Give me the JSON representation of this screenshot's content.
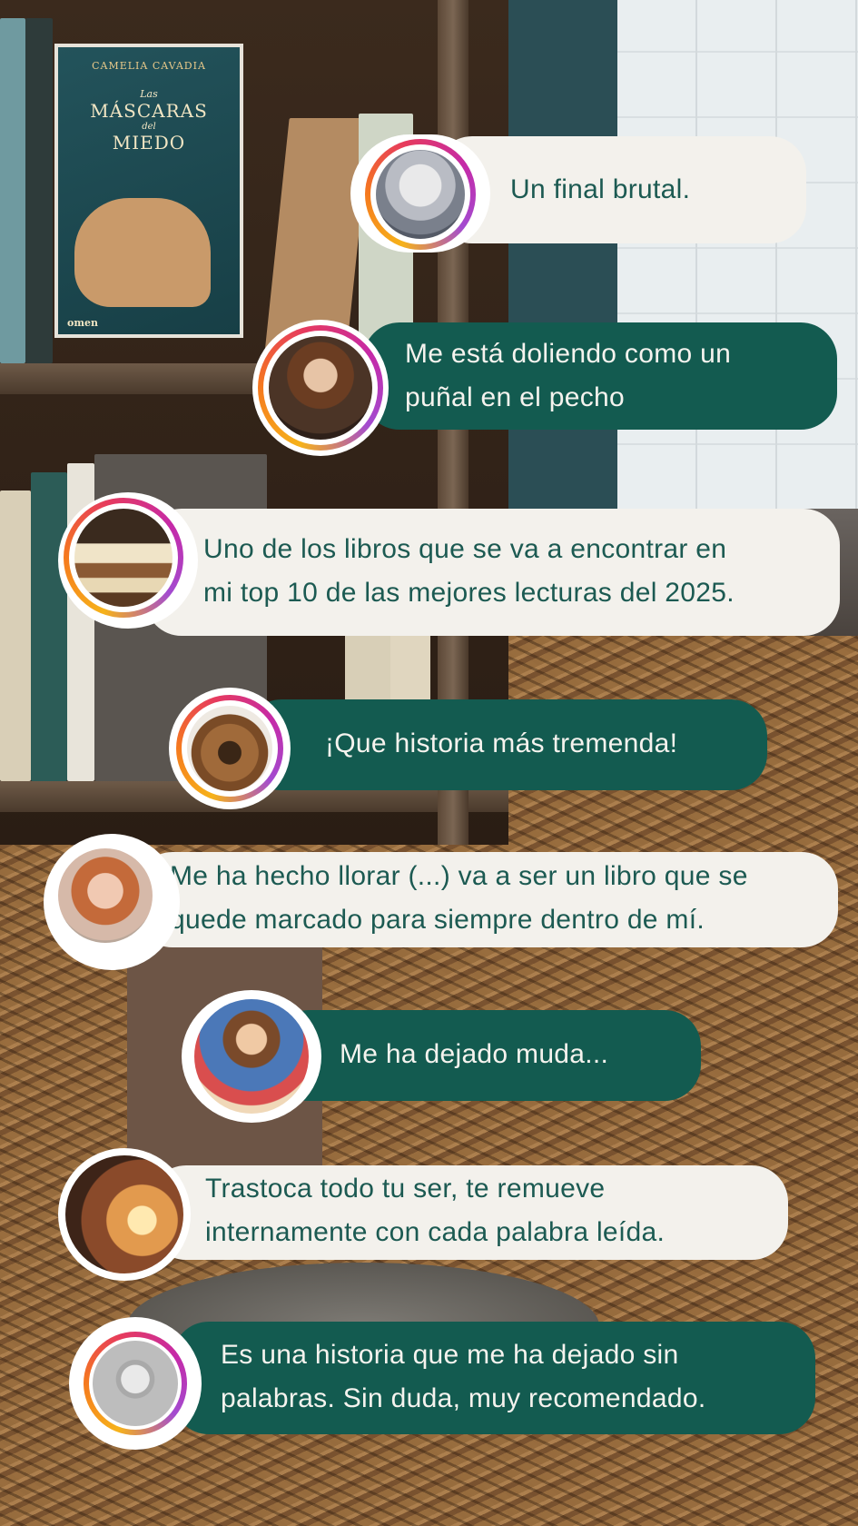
{
  "book": {
    "author": "CAMELIA CAVADIA",
    "title_prefix": "Las",
    "title_main": "MÁSCARAS",
    "title_del": "del",
    "title_end": "MIEDO",
    "publisher": "omen"
  },
  "comments": [
    {
      "lines": [
        "Un final brutal."
      ],
      "style": "light",
      "avatar": "motorcycle-rider-avatar"
    },
    {
      "lines": [
        "Me está doliendo como un",
        "puñal en el pecho"
      ],
      "style": "dark",
      "avatar": "girl-reading-avatar"
    },
    {
      "lines": [
        "Uno de los libros que se va a encontrar en",
        "mi top 10 de las mejores lecturas del 2025."
      ],
      "style": "light",
      "avatar": "open-books-avatar"
    },
    {
      "lines": [
        "¡Que historia más tremenda!"
      ],
      "style": "dark",
      "avatar": "vintage-radio-avatar"
    },
    {
      "lines": [
        "Me ha hecho llorar (...) va a ser un libro que se",
        "quede marcado para siempre dentro de mí."
      ],
      "style": "light",
      "avatar": "smiling-woman-avatar"
    },
    {
      "lines": [
        "Me ha dejado muda..."
      ],
      "style": "dark",
      "avatar": "cartoon-reader-avatar"
    },
    {
      "lines": [
        "Trastoca todo tu ser, te remueve",
        "internamente con cada palabra leída."
      ],
      "style": "light",
      "avatar": "woman-sunlight-avatar"
    },
    {
      "lines": [
        "Es una historia que me ha dejado sin",
        "palabras. Sin duda, muy recomendado."
      ],
      "style": "dark",
      "avatar": "book-logo-avatar"
    }
  ]
}
